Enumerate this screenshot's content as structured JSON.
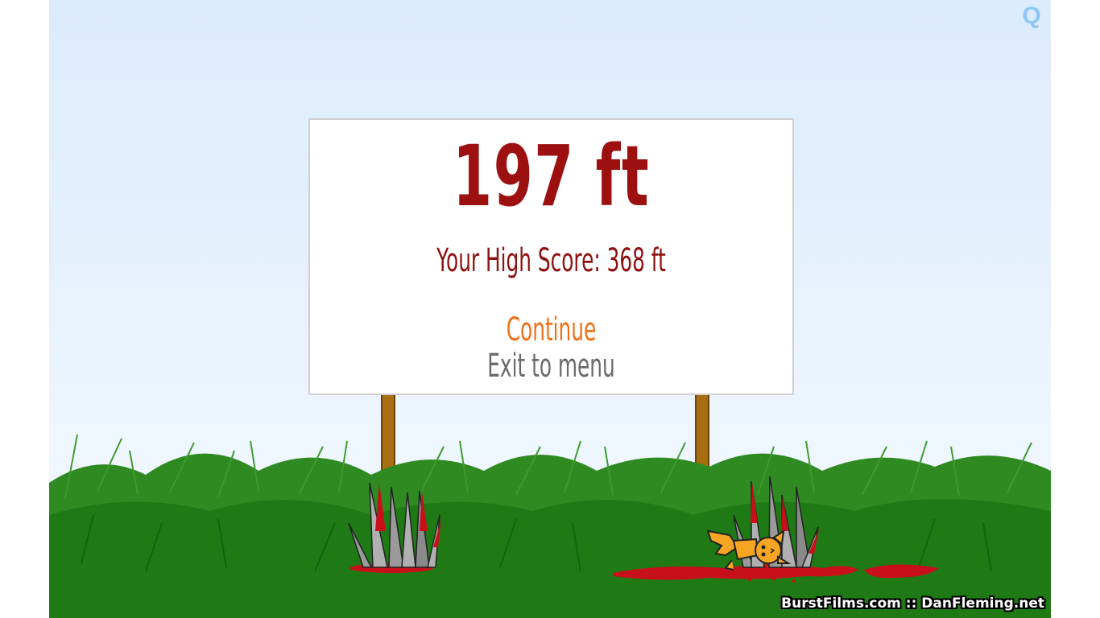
{
  "game": {
    "quality_button": "Q",
    "distance": "197 ft",
    "high_score": "Your High Score: 368 ft",
    "menu": {
      "continue_label": "Continue",
      "exit_label": "Exit to menu"
    },
    "credits": "BurstFilms.com :: DanFleming.net"
  },
  "colors": {
    "sky_top": "#dcebfd",
    "grass": "#1f7a16",
    "blood": "#c8101a",
    "score_text": "#9c1010",
    "continue_text": "#f07018",
    "exit_text": "#6a6a6a",
    "cat": "#f6a623"
  },
  "icons": [
    "quality-q-icon",
    "spike-trap-icon",
    "cat-character-icon",
    "blood-splatter-icon"
  ]
}
